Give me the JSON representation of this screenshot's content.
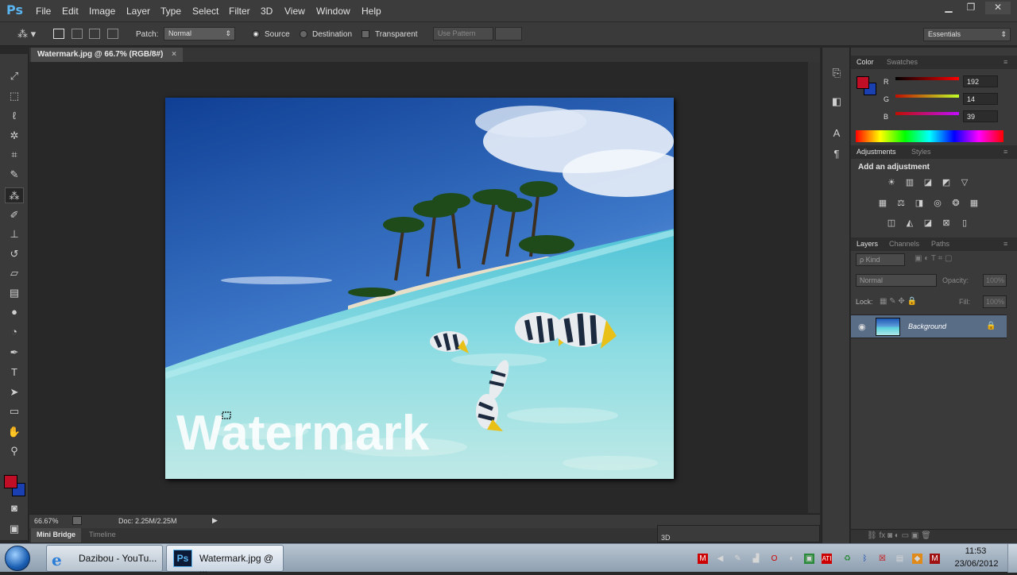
{
  "app": {
    "logo": "Ps"
  },
  "menu": [
    "File",
    "Edit",
    "Image",
    "Layer",
    "Type",
    "Select",
    "Filter",
    "3D",
    "View",
    "Window",
    "Help"
  ],
  "window_controls": {
    "minimize": "▁",
    "restore": "❐",
    "close": "✕"
  },
  "options_bar": {
    "tool_icon": "patch-tool-icon",
    "patch_label": "Patch:",
    "patch_mode": "Normal",
    "source_label": "Source",
    "destination_label": "Destination",
    "transparent_label": "Transparent",
    "use_pattern_label": "Use Pattern",
    "workspace": "Essentials"
  },
  "document": {
    "tab_title": "Watermark.jpg @ 66.7% (RGB/8#)",
    "tab_close": "×",
    "watermark_text": "Watermark",
    "zoom": "66.67%",
    "doc_size": "Doc: 2.25M/2.25M",
    "bottom_tabs": [
      "Mini Bridge",
      "Timeline"
    ],
    "dock_3d_label": "3D"
  },
  "tools": [
    "move-icon",
    "marquee-icon",
    "lasso-icon",
    "quick-select-icon",
    "crop-icon",
    "eyedropper-icon",
    "patch-icon",
    "brush-icon",
    "stamp-icon",
    "history-brush-icon",
    "eraser-icon",
    "gradient-icon",
    "blur-icon",
    "dodge-icon",
    "pen-icon",
    "type-icon",
    "path-select-icon",
    "shape-icon",
    "hand-icon",
    "zoom-icon"
  ],
  "colors": {
    "foreground": "#c00e27",
    "background": "#1a3fb0",
    "accent": "#5ab4f0"
  },
  "color_panel": {
    "tabs": [
      "Color",
      "Swatches"
    ],
    "r_label": "R",
    "g_label": "G",
    "b_label": "B",
    "r": "192",
    "g": "14",
    "b": "39"
  },
  "adjustments_panel": {
    "tabs": [
      "Adjustments",
      "Styles"
    ],
    "heading": "Add an adjustment"
  },
  "layers_panel": {
    "tabs": [
      "Layers",
      "Channels",
      "Paths"
    ],
    "kind_filter": "ρ Kind",
    "blend_mode": "Normal",
    "opacity_label": "Opacity:",
    "opacity": "100%",
    "lock_label": "Lock:",
    "fill_label": "Fill:",
    "fill": "100%",
    "layers": [
      {
        "name": "Background",
        "visible": true,
        "locked": true
      }
    ]
  },
  "taskbar": {
    "items": [
      {
        "label": "Dazibou - YouTu..."
      },
      {
        "label": "Watermark.jpg @ ..."
      }
    ],
    "time": "11:53",
    "date": "23/06/2012"
  }
}
